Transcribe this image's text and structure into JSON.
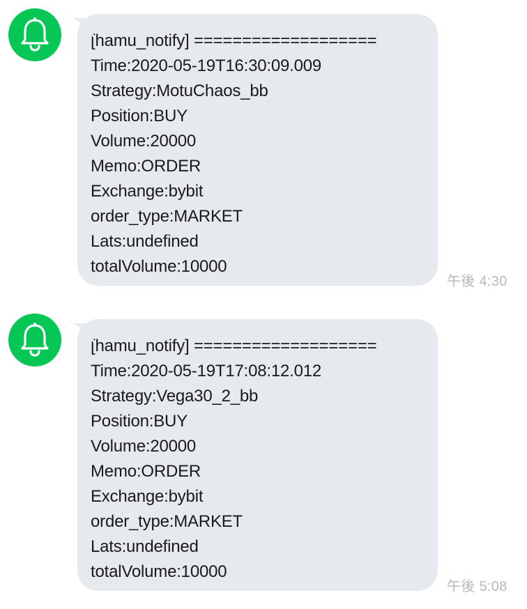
{
  "messages": [
    {
      "avatar_icon": "bell-icon",
      "lines": [
        "[hamu_notify] ===================",
        "Time:2020-05-19T16:30:09.009",
        "Strategy:MotuChaos_bb",
        "Position:BUY",
        "Volume:20000",
        "Memo:ORDER",
        "Exchange:bybit",
        "order_type:MARKET",
        "Lats:undefined",
        "totalVolume:10000"
      ],
      "time": "午後 4:30"
    },
    {
      "avatar_icon": "bell-icon",
      "lines": [
        "[hamu_notify] ===================",
        "Time:2020-05-19T17:08:12.012",
        "Strategy:Vega30_2_bb",
        "Position:BUY",
        "Volume:20000",
        "Memo:ORDER",
        "Exchange:bybit",
        "order_type:MARKET",
        "Lats:undefined",
        "totalVolume:10000"
      ],
      "time": "午後 5:08"
    }
  ],
  "colors": {
    "avatar": "#06c755",
    "bubble": "#e6e9ed",
    "text": "#1a1a1a",
    "timestamp": "#b6b9be"
  }
}
